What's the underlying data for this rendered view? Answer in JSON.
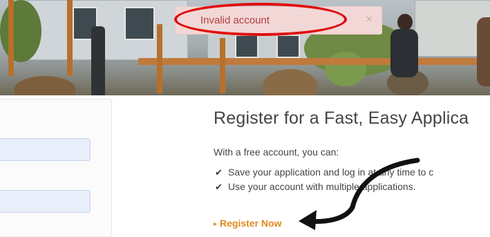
{
  "toast": {
    "message": "Invalid account",
    "close_label": "×"
  },
  "main": {
    "title": "Register for a Fast, Easy Applica",
    "intro": "With a free account, you can:",
    "benefits": [
      "Save your application and log in at any time to c",
      "Use your account with multiple applications."
    ],
    "register_link": "Register Now"
  },
  "icons": {
    "check": "✔",
    "register_caret": "▸"
  },
  "colors": {
    "toast_bg": "#f2d7d7",
    "toast_text": "#b1423f",
    "annotation_red": "#e00d0d",
    "link_orange": "#e08a1e",
    "input_bg": "#e8effb"
  }
}
